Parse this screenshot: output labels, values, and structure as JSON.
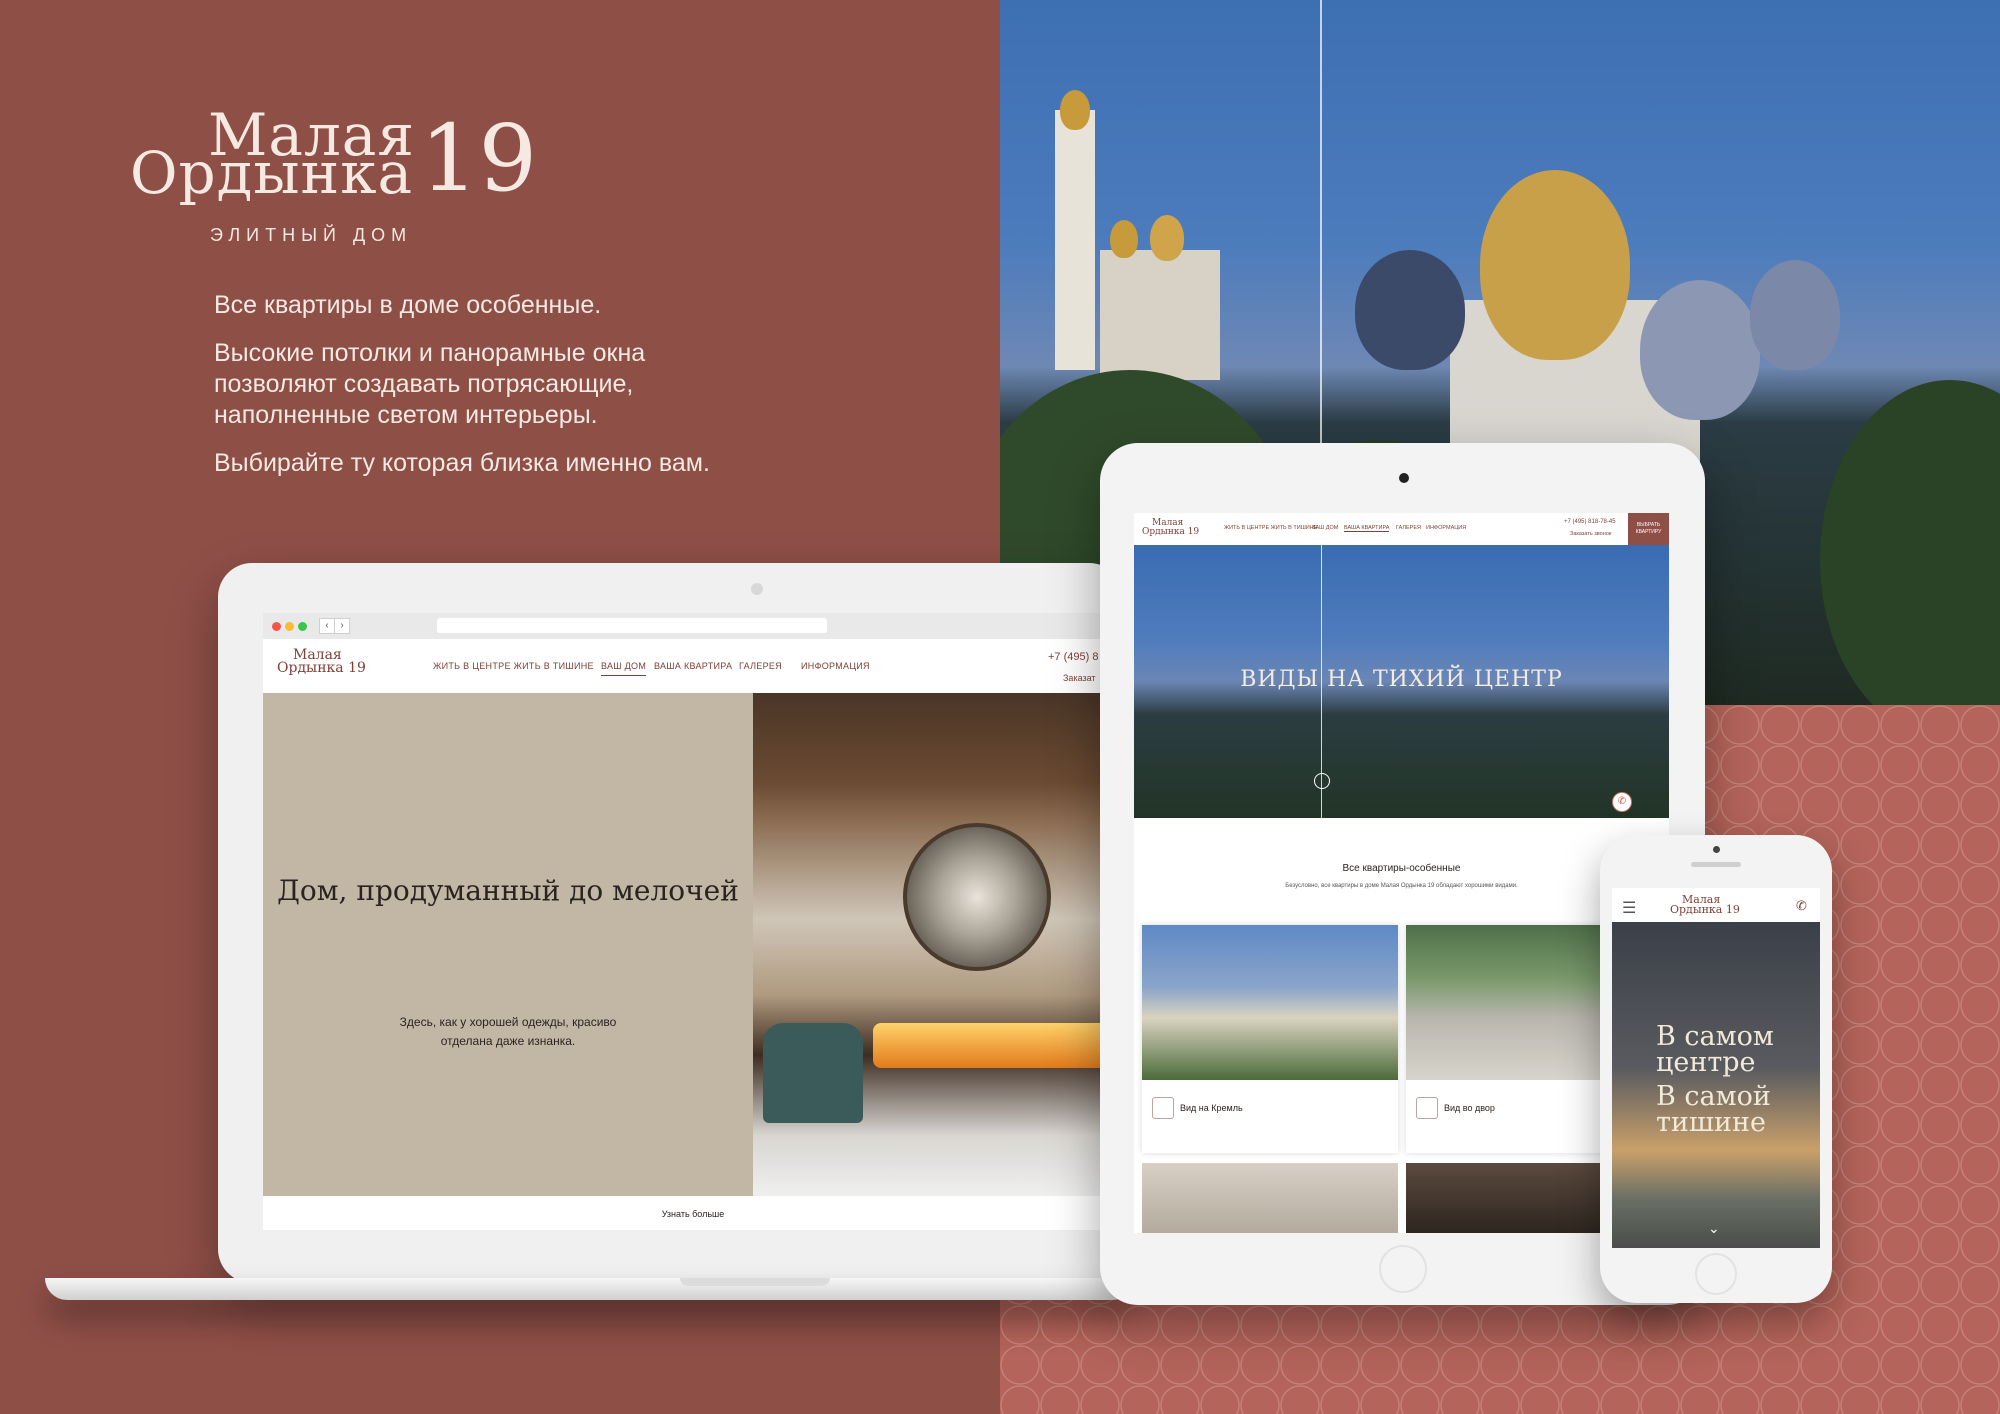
{
  "brand": {
    "line1": "Малая",
    "line2": "Ордынка",
    "number": "19",
    "tagline": "ЭЛИТНЫЙ ДОМ"
  },
  "intro": {
    "p1": "Все квартиры в доме особенные.",
    "p2": "Высокие потолки и панорамные окна позволяют создавать потрясающие, наполненные светом интерьеры.",
    "p3": "Выбирайте ту которая близка именно вам."
  },
  "colors": {
    "background": "#8e4f47",
    "accent": "#7f4038",
    "panel_beige": "#c2b7a4"
  },
  "laptop": {
    "logo_line1": "Малая",
    "logo_line2": "Ордынка 19",
    "nav": [
      "ЖИТЬ В ЦЕНТРЕ ЖИТЬ В ТИШИНЕ",
      "ВАШ ДОМ",
      "ВАША КВАРТИРА",
      "ГАЛЕРЕЯ",
      "ИНФОРМАЦИЯ"
    ],
    "active_nav": "ВАШ ДОМ",
    "phone": "+7 (495) 8",
    "order": "Заказат",
    "headline": "Дом, продуманный до мелочей",
    "body": "Здесь, как у хорошей одежды, красиво отделана даже изнанка.",
    "more": "Узнать больше"
  },
  "tablet": {
    "logo_line1": "Малая",
    "logo_line2": "Ордынка 19",
    "nav": [
      "ЖИТЬ В ЦЕНТРЕ ЖИТЬ В ТИШИНЕ",
      "ВАШ ДОМ",
      "ВАША КВАРТИРА",
      "ГАЛЕРЕЯ",
      "ИНФОРМАЦИЯ"
    ],
    "phone": "+7 (495) 818-78-45",
    "order": "Заказать звонок",
    "cta": "ВЫБРАТЬ КВАРТИРУ",
    "hero_title": "ВИДЫ НА ТИХИЙ ЦЕНТР",
    "section_title": "Все квартиры-особенные",
    "section_sub": "Безусловно, все квартиры в доме Малая Ордынка 19 обладают хорошими видами.",
    "cards": [
      {
        "label": "Вид на Кремль"
      },
      {
        "label": "Вид во двор"
      }
    ]
  },
  "phone": {
    "logo_line1": "Малая",
    "logo_line2": "Ордынка 19",
    "menu_icon": "hamburger-icon",
    "call_icon": "phone-icon",
    "hero_line1": "В самом",
    "hero_line2": "центре",
    "hero_line3": "В самой",
    "hero_line4": "тишине"
  }
}
